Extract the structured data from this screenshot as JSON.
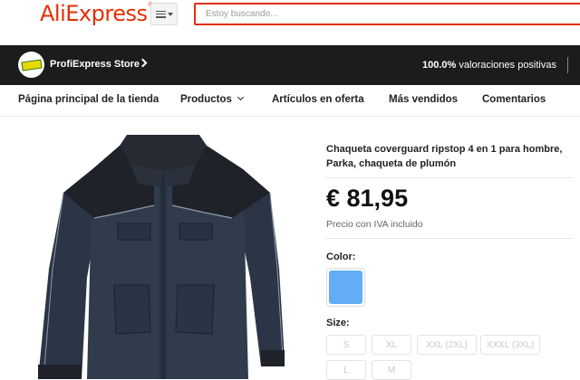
{
  "header": {
    "logo_text": "AliExpress",
    "search_placeholder": "Estoy buscando..."
  },
  "store": {
    "name": "ProfiExpress Store",
    "rating_value": "100.0%",
    "rating_text": " valoraciones positivas"
  },
  "nav": {
    "items": [
      {
        "label": "Página principal de la tienda"
      },
      {
        "label": "Productos"
      },
      {
        "label": "Artículos en oferta"
      },
      {
        "label": "Más vendidos"
      },
      {
        "label": "Comentarios"
      }
    ]
  },
  "product": {
    "title": "Chaqueta coverguard ripstop 4 en 1 para hombre, Parka, chaqueta de plumón",
    "price": "€ 81,95",
    "tax_note": "Precio con IVA incluido",
    "color_label": "Color:",
    "color_swatch": "#62adf3",
    "size_label": "Size:",
    "sizes": [
      "S",
      "XL",
      "XXL (2XL)",
      "XXXL (3XL)",
      "L",
      "M"
    ]
  },
  "colors": {
    "brand": "#e62e04",
    "store_bar": "#1c1c1c",
    "jacket_body": "#2f3a4b",
    "jacket_shoulder": "#1e2026"
  },
  "icons": [
    "menu-icon",
    "chevron-right-icon",
    "chevron-down-icon"
  ]
}
